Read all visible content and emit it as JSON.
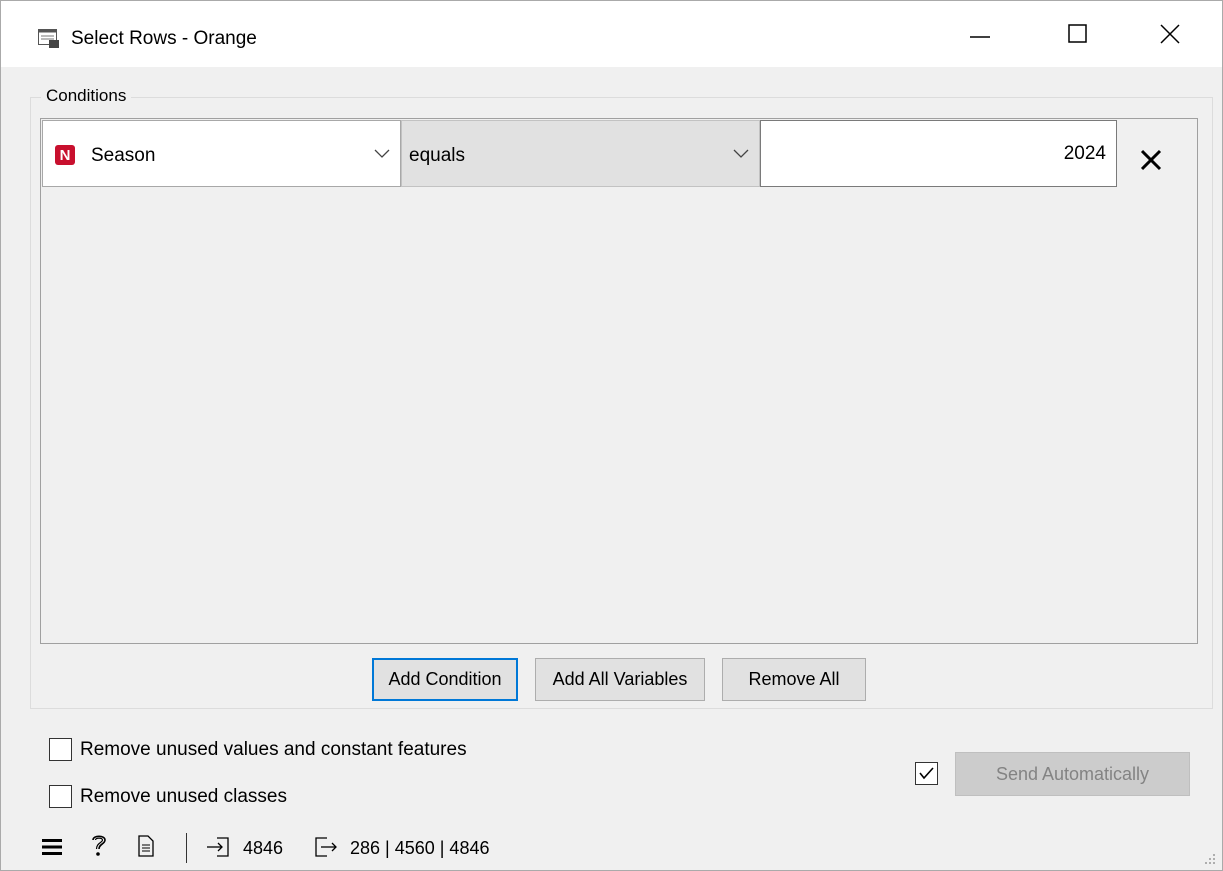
{
  "window": {
    "title": "Select Rows - Orange",
    "icons": [
      "app-icon",
      "minimize-icon",
      "maximize-icon",
      "close-icon"
    ]
  },
  "conditions": {
    "group_label": "Conditions",
    "rows": [
      {
        "variable_type_badge": "N",
        "variable": "Season",
        "operator": "equals",
        "value": "2024"
      }
    ],
    "buttons": {
      "add_condition": "Add Condition",
      "add_all_variables": "Add All Variables",
      "remove_all": "Remove All"
    }
  },
  "options": {
    "remove_unused_values": {
      "label": "Remove unused values and constant features",
      "checked": false
    },
    "remove_unused_classes": {
      "label": "Remove unused classes",
      "checked": false
    }
  },
  "send": {
    "auto_checked": true,
    "label": "Send Automatically"
  },
  "statusbar": {
    "input_count": "4846",
    "output_counts": "286 | 4560 | 4846",
    "icons": [
      "menu-icon",
      "help-icon",
      "report-icon",
      "input-icon",
      "output-icon"
    ]
  }
}
